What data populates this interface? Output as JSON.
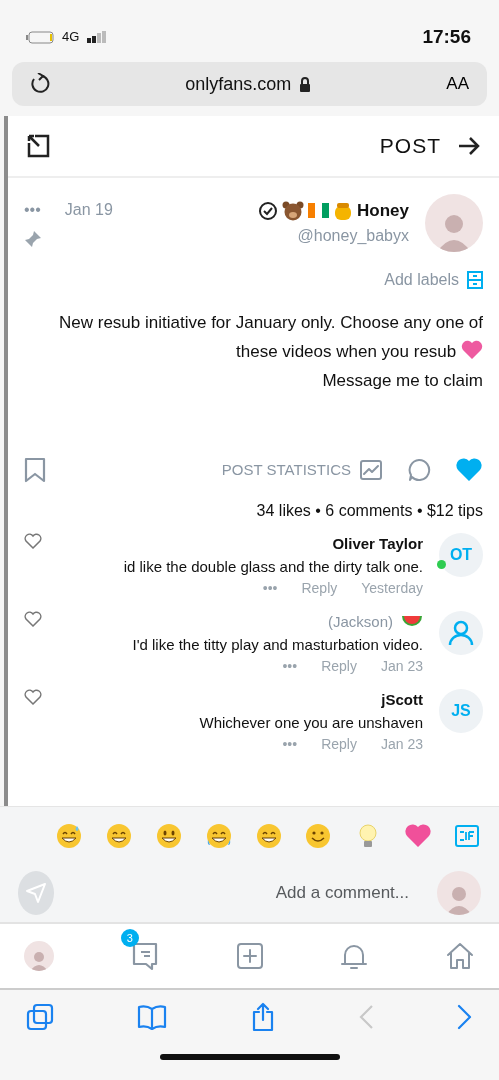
{
  "status_bar": {
    "time": "17:56",
    "network": "4G"
  },
  "address_bar": {
    "text_size": "AA",
    "url": "onlyfans.com"
  },
  "header": {
    "title": "POST"
  },
  "post": {
    "author": {
      "name": "Honey",
      "handle": "@honey_babyx"
    },
    "date": "Jan 19",
    "more": "•••",
    "add_labels": "Add labels",
    "paragraphs": [
      "New resub initiative for January only. Choose any one of these videos when you resub",
      "Message me to claim"
    ],
    "liked": true,
    "post_statistics": "POST STATISTICS",
    "stats": "34 likes • 6 comments • $12 tips"
  },
  "comments": [
    {
      "kind": "initials",
      "initials": "OT",
      "online": true,
      "name": "Oliver Taylor",
      "name_emoji": false,
      "text": "id like the double glass and the dirty talk one.",
      "time": "Yesterday",
      "reply": "Reply",
      "more": "•••"
    },
    {
      "kind": "icon",
      "online": false,
      "name": "(Jackson)",
      "name_emoji": true,
      "text": "I'd like the titty play and masturbation video.",
      "time": "Jan 23",
      "reply": "Reply",
      "more": "•••"
    },
    {
      "kind": "initials",
      "initials": "JS",
      "online": false,
      "name": "jScott",
      "name_emoji": false,
      "text": "Whichever one you are unshaven",
      "time": "Jan 23",
      "reply": "Reply",
      "more": "•••"
    }
  ],
  "emojis": [
    {
      "kind": "sweat"
    },
    {
      "kind": "grin"
    },
    {
      "kind": "smile"
    },
    {
      "kind": "joy"
    },
    {
      "kind": "grin"
    },
    {
      "kind": "slight"
    },
    {
      "kind": "bulb"
    },
    {
      "kind": "heart"
    }
  ],
  "comment_input": {
    "placeholder": "Add a comment..."
  },
  "bottom_nav": {
    "messages_badge": "3"
  }
}
